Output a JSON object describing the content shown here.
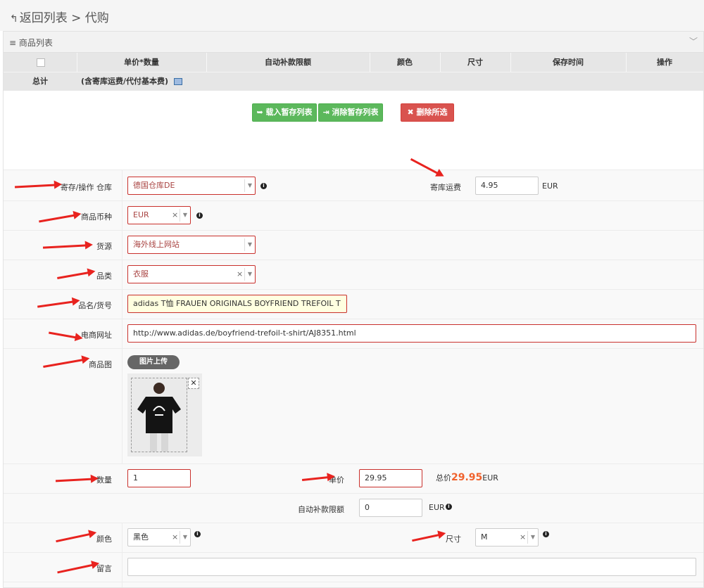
{
  "header": {
    "back_label": "返回列表",
    "separator": ">",
    "page": "代购"
  },
  "panel": {
    "title": "商品列表"
  },
  "table": {
    "columns": [
      "单价*数量",
      "自动补款限额",
      "颜色",
      "尺寸",
      "保存时间",
      "操作"
    ],
    "total_label": "总计",
    "total_note": "(含寄库运费/代付基本费)"
  },
  "actions": {
    "load": "载入暂存列表",
    "clear": "消除暂存列表",
    "delete": "删除所选"
  },
  "form": {
    "warehouse": {
      "label": "寄存/操作 仓库",
      "value": "德国仓库DE"
    },
    "shipping": {
      "label": "寄库运费",
      "value": "4.95",
      "unit": "EUR"
    },
    "currency": {
      "label": "商品币种",
      "value": "EUR"
    },
    "source": {
      "label": "货源",
      "value": "海外线上网站"
    },
    "category": {
      "label": "品类",
      "value": "衣服"
    },
    "product_name": {
      "label": "品名/货号",
      "value": "adidas T恤 FRAUEN ORIGINALS BOYFRIEND TREFOIL T"
    },
    "url": {
      "label": "电商网址",
      "value": "http://www.adidas.de/boyfriend-trefoil-t-shirt/AJ8351.html"
    },
    "image": {
      "label": "商品图",
      "upload_label": "图片上传"
    },
    "quantity": {
      "label": "数量",
      "value": "1"
    },
    "unit_price": {
      "label": "单价",
      "value": "29.95"
    },
    "total": {
      "label": "总价",
      "value": "29.95",
      "unit": "EUR"
    },
    "auto_limit": {
      "label": "自动补款限额",
      "value": "0",
      "unit": "EUR"
    },
    "color": {
      "label": "颜色",
      "value": "黑色"
    },
    "size": {
      "label": "尺寸",
      "value": "M"
    },
    "message": {
      "label": "留言",
      "value": ""
    }
  },
  "colors": {
    "green": "#5cb85c",
    "red": "#d9534f",
    "annotation": "#e8231f",
    "total": "#f0622d"
  }
}
